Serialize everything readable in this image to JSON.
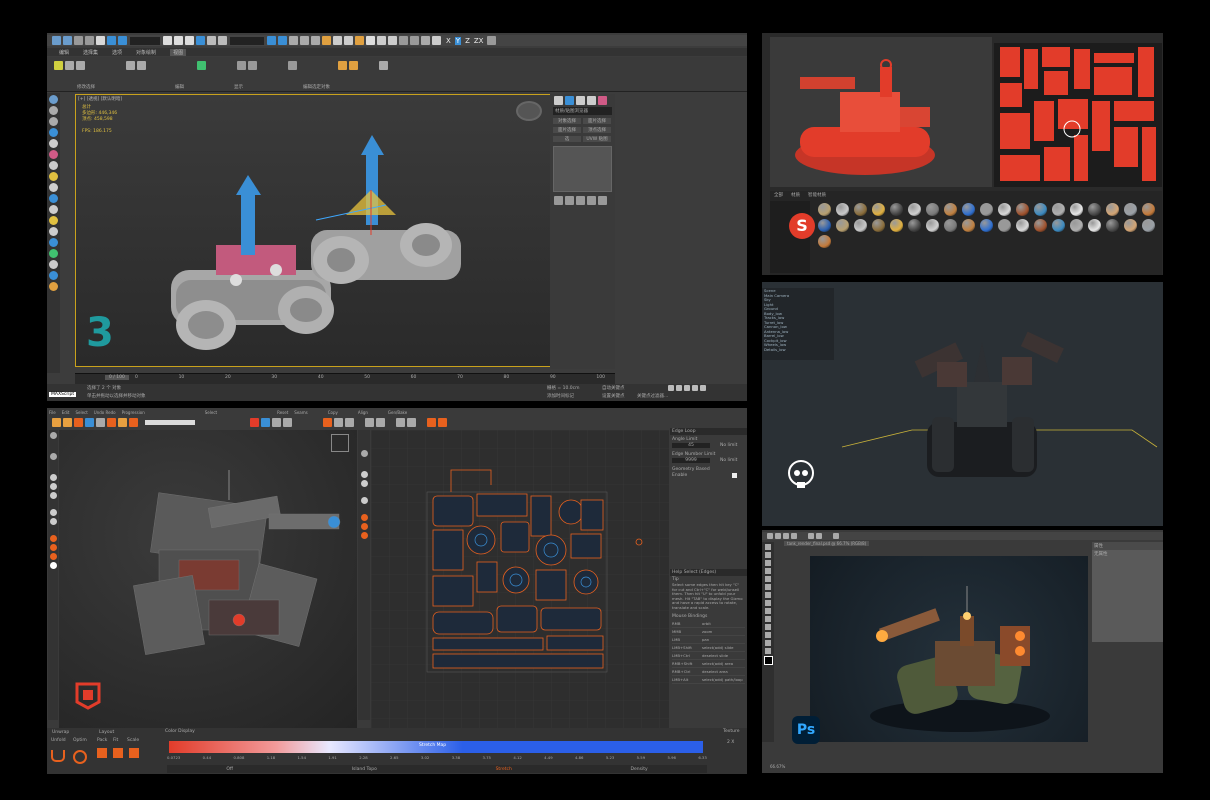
{
  "max": {
    "menus": [
      "编辑",
      "选择集",
      "选项",
      "对象绘制",
      "视图"
    ],
    "ribbon_groups": [
      "修改选择",
      "编辑",
      "显示",
      "编辑选定对象"
    ],
    "viewport_label": "[+] [透视] [默认明暗]",
    "stats": {
      "head": "总计",
      "l1k": "多边形:",
      "l1v": "446,346",
      "l2k": "顶点:",
      "l2v": "458,598",
      "l3k": "FPS:",
      "l3v": "186.175"
    },
    "side_panel": {
      "title": "材质/贴图浏览器",
      "b1": "对象选择",
      "b2": "面片选择",
      "b3": "面片选择",
      "b4": "顶点选择",
      "b5": "选",
      "b6": "UVW 贴图"
    },
    "timeline": {
      "start": "0 / 100",
      "ticks": [
        "0",
        "10",
        "20",
        "30",
        "40",
        "50",
        "60",
        "70",
        "80",
        "90",
        "100"
      ]
    },
    "status": {
      "line1": "选择了 2 个 对象",
      "line2": "单击并拖动以选择并移动对象",
      "maxscript": "MAXScript",
      "grid": "栅格 = 10.0cm",
      "addtime": "添加时间标记",
      "autokey": "自动关键点",
      "setkey": "设置关键点",
      "filters": "关键点过滤器..."
    },
    "toolbar_axes": [
      "X",
      "Y",
      "Z",
      "ZX"
    ],
    "logo_text": "3"
  },
  "painter": {
    "shelf_tabs": [
      "全部",
      "材质",
      "智能材质"
    ],
    "logo_text": "S"
  },
  "marmoset": {
    "scene_items": [
      "Scene",
      "Main Camera",
      "Sky",
      "Light",
      "Ground",
      "Body_low",
      "Tracks_low",
      "Turret_low",
      "Cannon_low",
      "Antenna_low",
      "Barrel_low",
      "Cockpit_low",
      "Wheels_low",
      "Details_low",
      "Hatch_low"
    ]
  },
  "rizom": {
    "menus": [
      "File",
      "Edit",
      "Select",
      "Undo Redo",
      "Progression",
      "Select",
      "Reset",
      "Seams",
      "Copy",
      "Align",
      "Gen/Bake"
    ],
    "edge_loop": {
      "title": "Edge Loop",
      "angle": "Angle Limit",
      "angle_v": "45",
      "nolimit1": "No limit",
      "number": "Edge Number Limit",
      "number_v": "9999",
      "nolimit2": "No limit",
      "geom": "Geometry Based",
      "enable": "Enable"
    },
    "help": {
      "title": "Help Select (Edges)",
      "tip": "Tip",
      "text": "Select some edges then hit key \"C\" for cut and Ctrl+\"C\" for weld/unsell them. Then hit \"U\" to unfold your mesh. Hit \"TAB\" to display the Gizmo and have a rapid access to rotate, translate and scale.",
      "bindings_title": "Mouse Bindings",
      "bindings": [
        [
          "RMB",
          "orbit"
        ],
        [
          "MMB",
          "zoom"
        ],
        [
          "LMB",
          "pan"
        ],
        [
          "LMB+Shift",
          "select(add) slide"
        ],
        [
          "LMB+Ctrl",
          "deselect slide"
        ],
        [
          "RMB+Shift",
          "select(add) area"
        ],
        [
          "RMB+Ctrl",
          "deselect area"
        ],
        [
          "LMB+Alt",
          "select(add) path/loop"
        ]
      ]
    },
    "bottom": {
      "unwrap": "Unwrap",
      "unfold": "Unfold",
      "optim": "Optim",
      "layout": "Layout",
      "pack": "Pack",
      "fit": "Fit",
      "scale": "Scale",
      "color_display": "Color Display",
      "stretch_map": "Stretch Map",
      "ticks": [
        "0.0723",
        "0.44",
        "0.808",
        "1.18",
        "1.54",
        "1.91",
        "2.28",
        "2.65",
        "3.02",
        "3.38",
        "3.75",
        "4.12",
        "4.49",
        "4.86",
        "5.23",
        "5.59",
        "5.96",
        "6.33"
      ],
      "modes": [
        "Off",
        "Island Topo",
        "Stretch",
        "Density"
      ],
      "texture": "Texture",
      "tex_v": "2 X"
    }
  },
  "photoshop": {
    "logo_text": "Ps",
    "tab": "tank_render_final.psd @ 66.7% (RGB/8)",
    "zoom": "66.67%",
    "panel_label": "属性",
    "panel_sub": "无属性"
  },
  "colors": {
    "accent_orange": "#e8711e",
    "max_blue": "#3a8fd6",
    "max_pink": "#d05a86",
    "painter_red": "#e23c2a",
    "rizom_orange": "#e8611e",
    "ps_blue": "#2fa8ff"
  }
}
